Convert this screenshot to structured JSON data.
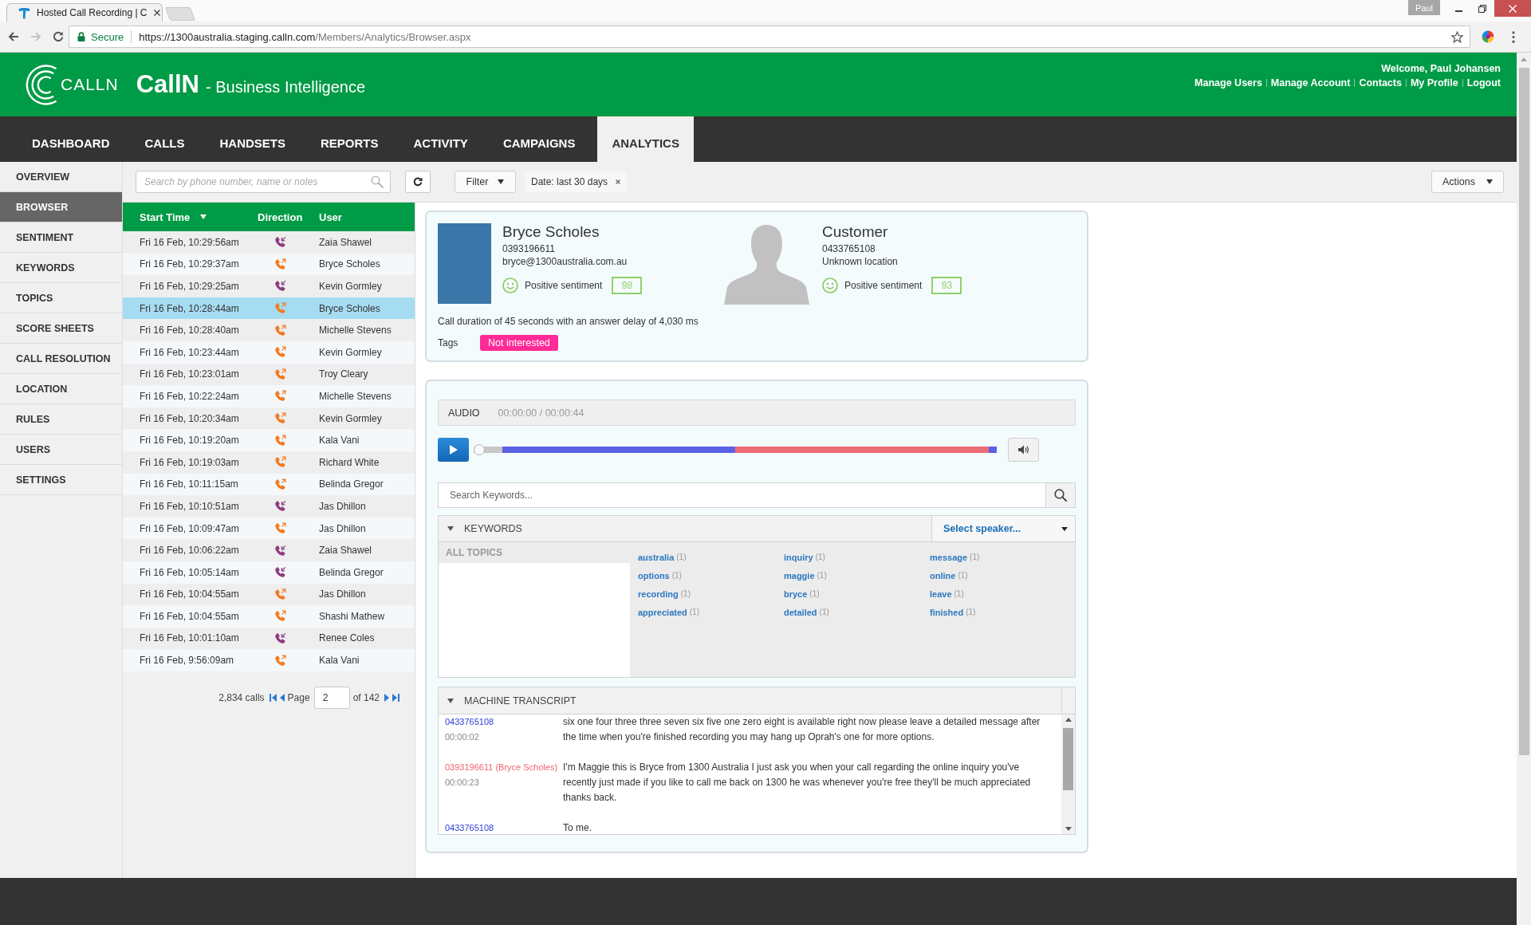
{
  "browser": {
    "tab_title": "Hosted Call Recording | C",
    "profile": "Paul",
    "security_label": "Secure",
    "url_host": "https://1300australia.staging.calln.com",
    "url_path": "/Members/Analytics/Browser.aspx"
  },
  "header": {
    "logo_text": "CALLN",
    "app_name": "CallN",
    "subtitle": "- Business Intelligence",
    "welcome": "Welcome, Paul Johansen",
    "links": [
      "Manage Users",
      "Manage Account",
      "Contacts",
      "My Profile",
      "Logout"
    ]
  },
  "nav": {
    "tabs": [
      {
        "label": "DASHBOARD",
        "selected": false
      },
      {
        "label": "CALLS",
        "selected": false
      },
      {
        "label": "HANDSETS",
        "selected": false
      },
      {
        "label": "REPORTS",
        "selected": false
      },
      {
        "label": "ACTIVITY",
        "selected": false
      },
      {
        "label": "CAMPAIGNS",
        "selected": false
      },
      {
        "label": "ANALYTICS",
        "selected": true
      }
    ]
  },
  "sidebar": {
    "items": [
      {
        "label": "OVERVIEW",
        "selected": false
      },
      {
        "label": "BROWSER",
        "selected": true
      },
      {
        "label": "SENTIMENT",
        "selected": false
      },
      {
        "label": "KEYWORDS",
        "selected": false
      },
      {
        "label": "TOPICS",
        "selected": false
      },
      {
        "label": "SCORE SHEETS",
        "selected": false
      },
      {
        "label": "CALL RESOLUTION",
        "selected": false
      },
      {
        "label": "LOCATION",
        "selected": false
      },
      {
        "label": "RULES",
        "selected": false
      },
      {
        "label": "USERS",
        "selected": false
      },
      {
        "label": "SETTINGS",
        "selected": false
      }
    ]
  },
  "toolbar": {
    "search": {
      "placeholder": "Search by phone number, name or notes"
    },
    "filter_label": "Filter",
    "date_filter": "Date: last 30 days",
    "actions_label": "Actions"
  },
  "calls": {
    "columns": [
      "Start Time",
      "Direction",
      "User"
    ],
    "rows": [
      {
        "start_time": "Fri 16 Feb, 10:29:56am",
        "kind": "inbound",
        "user": "Zaia Shawel",
        "selected": false
      },
      {
        "start_time": "Fri 16 Feb, 10:29:37am",
        "kind": "outbound",
        "user": "Bryce Scholes",
        "selected": false
      },
      {
        "start_time": "Fri 16 Feb, 10:29:25am",
        "kind": "inbound",
        "user": "Kevin Gormley",
        "selected": false
      },
      {
        "start_time": "Fri 16 Feb, 10:28:44am",
        "kind": "outbound",
        "user": "Bryce Scholes",
        "selected": true
      },
      {
        "start_time": "Fri 16 Feb, 10:28:40am",
        "kind": "outbound",
        "user": "Michelle Stevens",
        "selected": false
      },
      {
        "start_time": "Fri 16 Feb, 10:23:44am",
        "kind": "outbound",
        "user": "Kevin Gormley",
        "selected": false
      },
      {
        "start_time": "Fri 16 Feb, 10:23:01am",
        "kind": "outbound",
        "user": "Troy Cleary",
        "selected": false
      },
      {
        "start_time": "Fri 16 Feb, 10:22:24am",
        "kind": "outbound",
        "user": "Michelle Stevens",
        "selected": false
      },
      {
        "start_time": "Fri 16 Feb, 10:20:34am",
        "kind": "outbound",
        "user": "Kevin Gormley",
        "selected": false
      },
      {
        "start_time": "Fri 16 Feb, 10:19:20am",
        "kind": "outbound",
        "user": "Kala Vani",
        "selected": false
      },
      {
        "start_time": "Fri 16 Feb, 10:19:03am",
        "kind": "outbound",
        "user": "Richard White",
        "selected": false
      },
      {
        "start_time": "Fri 16 Feb, 10:11:15am",
        "kind": "outbound",
        "user": "Belinda Gregor",
        "selected": false
      },
      {
        "start_time": "Fri 16 Feb, 10:10:51am",
        "kind": "inbound",
        "user": "Jas Dhillon",
        "selected": false
      },
      {
        "start_time": "Fri 16 Feb, 10:09:47am",
        "kind": "outbound",
        "user": "Jas Dhillon",
        "selected": false
      },
      {
        "start_time": "Fri 16 Feb, 10:06:22am",
        "kind": "inbound",
        "user": "Zaia Shawel",
        "selected": false
      },
      {
        "start_time": "Fri 16 Feb, 10:05:14am",
        "kind": "inbound",
        "user": "Belinda Gregor",
        "selected": false
      },
      {
        "start_time": "Fri 16 Feb, 10:04:55am",
        "kind": "outbound",
        "user": "Jas Dhillon",
        "selected": false
      },
      {
        "start_time": "Fri 16 Feb, 10:04:55am",
        "kind": "outbound",
        "user": "Shashi Mathew",
        "selected": false
      },
      {
        "start_time": "Fri 16 Feb, 10:01:10am",
        "kind": "inbound",
        "user": "Renee Coles",
        "selected": false
      },
      {
        "start_time": "Fri 16 Feb, 9:56:09am",
        "kind": "outbound",
        "user": "Kala Vani",
        "selected": false
      }
    ],
    "pagination": {
      "total": "2,834 calls",
      "page_label": "Page",
      "page": "2",
      "of_pages": "of 142"
    }
  },
  "call_detail": {
    "agent": {
      "name": "Bryce Scholes",
      "phone": "0393196611",
      "email": "bryce@1300australia.com.au",
      "sentiment": "Positive sentiment",
      "score": "98"
    },
    "customer": {
      "name": "Customer",
      "phone": "0433765108",
      "location": "Unknown location",
      "sentiment": "Positive sentiment",
      "score": "93"
    },
    "summary": "Call duration of 45 seconds with an answer delay of 4,030 ms",
    "tags_label": "Tags",
    "tags": [
      "Not interested"
    ]
  },
  "audio": {
    "label": "AUDIO",
    "time": "00:00:00 / 00:00:44",
    "level": 0
  },
  "keyword_search": {
    "placeholder": "Search Keywords..."
  },
  "keywords": {
    "title": "KEYWORDS",
    "speaker_select": "Select speaker...",
    "topics_heading": "ALL TOPICS",
    "items": [
      {
        "word": "australia",
        "count": "(1)"
      },
      {
        "word": "inquiry",
        "count": "(1)"
      },
      {
        "word": "message",
        "count": "(1)"
      },
      {
        "word": "options",
        "count": "(1)"
      },
      {
        "word": "maggie",
        "count": "(1)"
      },
      {
        "word": "online",
        "count": "(1)"
      },
      {
        "word": "recording",
        "count": "(1)"
      },
      {
        "word": "bryce",
        "count": "(1)"
      },
      {
        "word": "leave",
        "count": "(1)"
      },
      {
        "word": "appreciated",
        "count": "(1)"
      },
      {
        "word": "detailed",
        "count": "(1)"
      },
      {
        "word": "finished",
        "count": "(1)"
      }
    ]
  },
  "transcript": {
    "title": "MACHINE TRANSCRIPT",
    "entries": [
      {
        "kind": "customer",
        "speaker": "0433765108",
        "time": "00:00:02",
        "text": "six one four three three seven six five one zero eight is available right now please leave a detailed message after the time when you're finished recording you may hang up Oprah's one for more options."
      },
      {
        "kind": "agent",
        "speaker": "0393196611 (Bryce Scholes)",
        "time": "00:00:23",
        "text": "I'm Maggie this is Bryce from 1300 Australia I just ask you when your call regarding the online inquiry you've recently just made if you like to call me back on 1300 he was whenever you're free they'll be much appreciated thanks back."
      },
      {
        "kind": "customer",
        "speaker": "0433765108",
        "text": "To me."
      }
    ]
  }
}
